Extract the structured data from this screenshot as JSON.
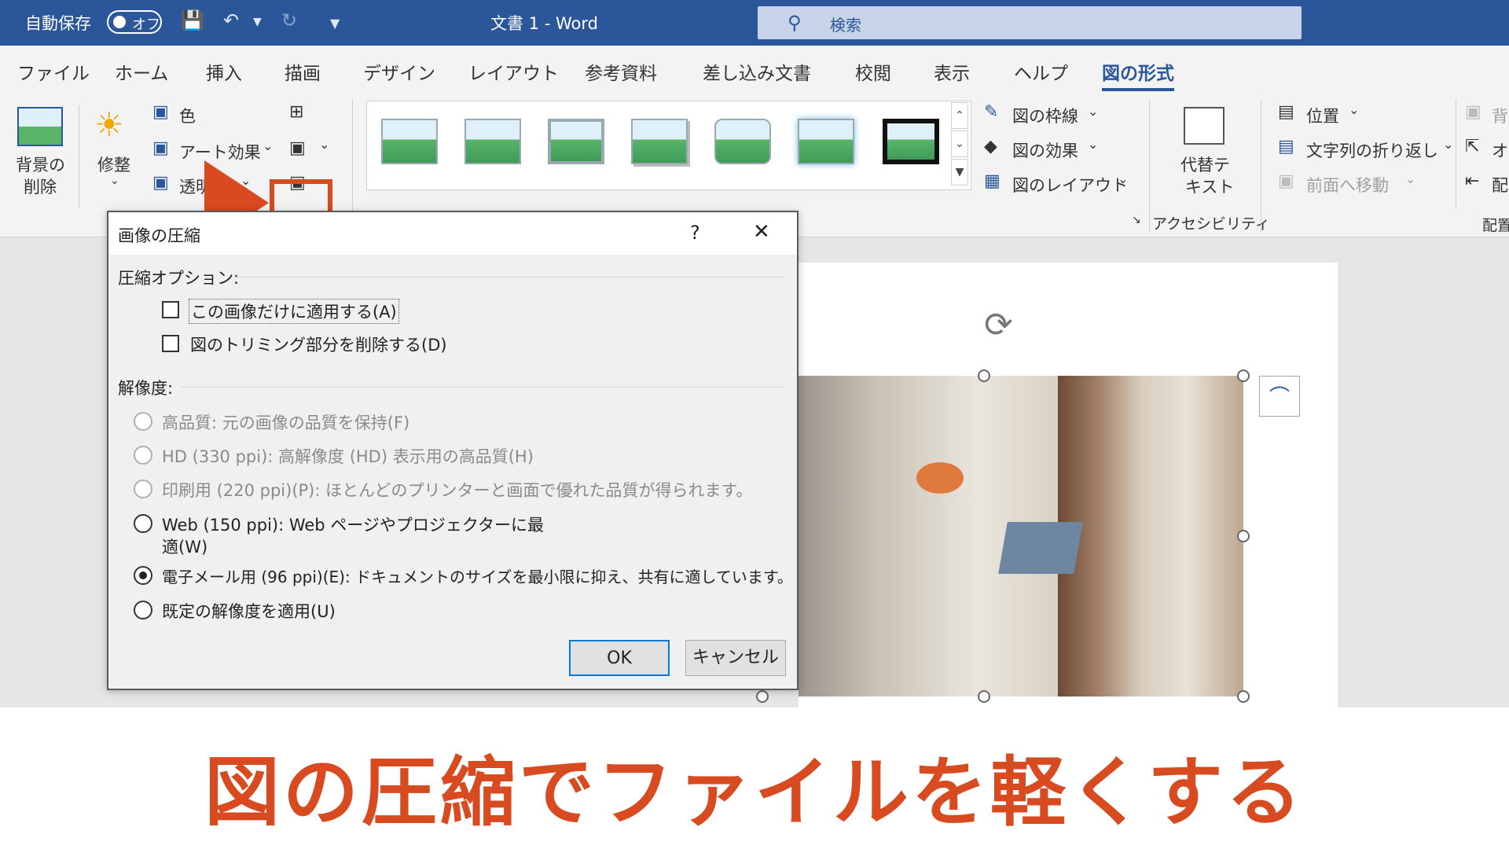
{
  "titlebar": {
    "autosave_label": "自動保存",
    "autosave_state": "オフ",
    "doc_title": "文書 1  -  Word",
    "search_placeholder": "検索"
  },
  "tabs": [
    "ファイル",
    "ホーム",
    "挿入",
    "描画",
    "デザイン",
    "レイアウト",
    "参考資料",
    "差し込み文書",
    "校閲",
    "表示",
    "ヘルプ",
    "図の形式"
  ],
  "active_tab": "図の形式",
  "ribbon": {
    "remove_bg": [
      "背景の",
      "削除"
    ],
    "corrections": "修整",
    "color": "色",
    "artistic": "アート効果",
    "transparency": "透明度",
    "picture_border": "図の枠線",
    "picture_effects": "図の効果",
    "picture_layout": "図のレイアウト",
    "alt_text": [
      "代替テ",
      "キスト"
    ],
    "accessibility": "アクセシビリティ",
    "position": "位置",
    "wrap_text": "文字列の折り返し",
    "bring_forward": "前面へ移動",
    "arrange_partial": "配置",
    "send_partial": "背",
    "select_partial": "オ",
    "align_partial": "配"
  },
  "dialog": {
    "title": "画像の圧縮",
    "help": "?",
    "close": "✕",
    "compress_options_label": "圧縮オプション:",
    "apply_only_this": "この画像だけに適用する(A)",
    "delete_cropped": "図のトリミング部分を削除する(D)",
    "resolution_label": "解像度:",
    "options": [
      {
        "label": "高品質: 元の画像の品質を保持(F)",
        "enabled": false,
        "selected": false
      },
      {
        "label": "HD (330 ppi): 高解像度 (HD) 表示用の高品質(H)",
        "enabled": false,
        "selected": false
      },
      {
        "label": "印刷用 (220 ppi)(P): ほとんどのプリンターと画面で優れた品質が得られます。",
        "enabled": false,
        "selected": false
      },
      {
        "label": "Web (150 ppi): Web ページやプロジェクターに最",
        "label2": "適(W)",
        "enabled": true,
        "selected": false
      },
      {
        "label": "電子メール用 (96 ppi)(E): ドキュメントのサイズを最小限に抑え、共有に適しています。",
        "enabled": true,
        "selected": true
      },
      {
        "label": "既定の解像度を適用(U)",
        "enabled": true,
        "selected": false
      }
    ],
    "ok": "OK",
    "cancel": "キャンセル"
  },
  "caption": "図の圧縮でファイルを軽くする",
  "colors": {
    "word_blue": "#2b579a",
    "accent_red": "#d84a20"
  }
}
